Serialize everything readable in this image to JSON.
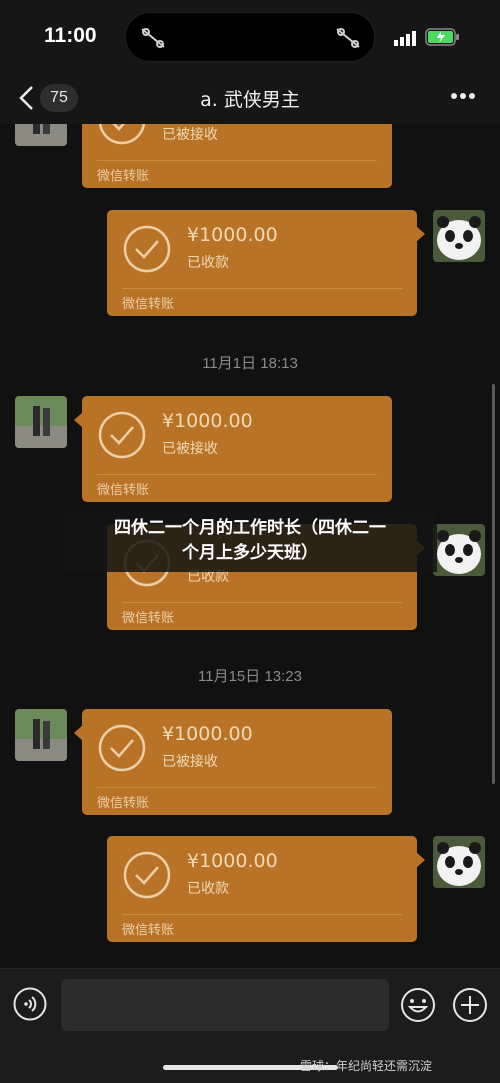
{
  "status_bar": {
    "time": "11:00"
  },
  "nav": {
    "unread_count": "75",
    "title": "a. 武侠男主"
  },
  "messages": [
    {
      "side": "left",
      "amount": "",
      "status": "已被接收",
      "footer": "微信转账"
    },
    {
      "side": "right",
      "amount": "¥1000.00",
      "status": "已收款",
      "footer": "微信转账"
    },
    {
      "side": "left",
      "amount": "¥1000.00",
      "status": "已被接收",
      "footer": "微信转账"
    },
    {
      "side": "right",
      "amount": "",
      "status": "已收款",
      "footer": "微信转账"
    },
    {
      "side": "left",
      "amount": "¥1000.00",
      "status": "已被接收",
      "footer": "微信转账"
    },
    {
      "side": "right",
      "amount": "¥1000.00",
      "status": "已收款",
      "footer": "微信转账"
    }
  ],
  "timestamps": [
    "11月1日 18:13",
    "11月15日 13:23"
  ],
  "overlay": {
    "line1": "四休二一个月的工作时长（四休二一",
    "line2": "个月上多少天班）"
  },
  "input": {
    "placeholder": ""
  },
  "watermark": "雪球：年纪尚轻还需沉淀",
  "colors": {
    "bubble": "#b87327",
    "background": "#111111",
    "bubble_text": "#f1d9b5"
  },
  "icons": [
    "chevron-left-icon",
    "more-icon",
    "check-circle-icon",
    "voice-icon",
    "emoji-icon",
    "plus-icon",
    "signal-icon",
    "battery-icon"
  ]
}
